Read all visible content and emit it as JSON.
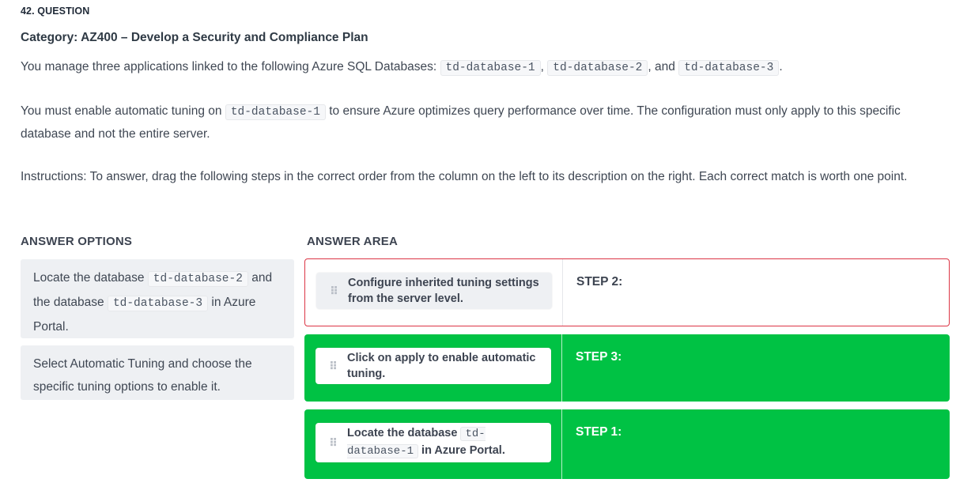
{
  "question": {
    "number": "42. QUESTION",
    "category": "Category: AZ400 – Develop a Security and Compliance Plan",
    "p1": {
      "text1": "You manage three applications linked to the following Azure SQL Databases:",
      "code1": "td-database-1",
      "sep1": ",",
      "code2": "td-database-2",
      "sep2": ", and",
      "code3": "td-database-3",
      "end": "."
    },
    "p2": {
      "text1": "You must enable automatic tuning on",
      "code1": "td-database-1",
      "text2": "to ensure Azure optimizes query performance over time. The configuration must only apply to this specific database and not the entire server."
    },
    "p3": "Instructions: To answer, drag the following steps in the correct order from the column on the left to its description on the right. Each correct match is worth one point."
  },
  "answer_options": {
    "header": "ANSWER OPTIONS",
    "items": [
      {
        "t1": "Locate the database",
        "c1": "td-database-2",
        "t2": "and the database",
        "c2": "td-database-3",
        "t3": "in Azure Portal."
      },
      {
        "t1": "Select Automatic Tuning and choose the specific tuning options to enable it."
      }
    ]
  },
  "answer_area": {
    "header": "ANSWER AREA",
    "rows": [
      {
        "chip": "Configure inherited tuning settings from the server level.",
        "step": "STEP 2:",
        "status": "incorrect"
      },
      {
        "chip": "Click on apply to enable automatic tuning.",
        "step": "STEP 3:",
        "status": "correct"
      },
      {
        "chip_t1": "Locate the database",
        "chip_c1": "td-database-1",
        "chip_t2": "in Azure Portal.",
        "step": "STEP 1:",
        "status": "correct"
      }
    ]
  },
  "colors": {
    "correct": "#00c244",
    "incorrect_border": "#dc3545",
    "option_bg": "#eef0f3"
  },
  "icons": {
    "drag_handle": "drag-handle-icon"
  }
}
